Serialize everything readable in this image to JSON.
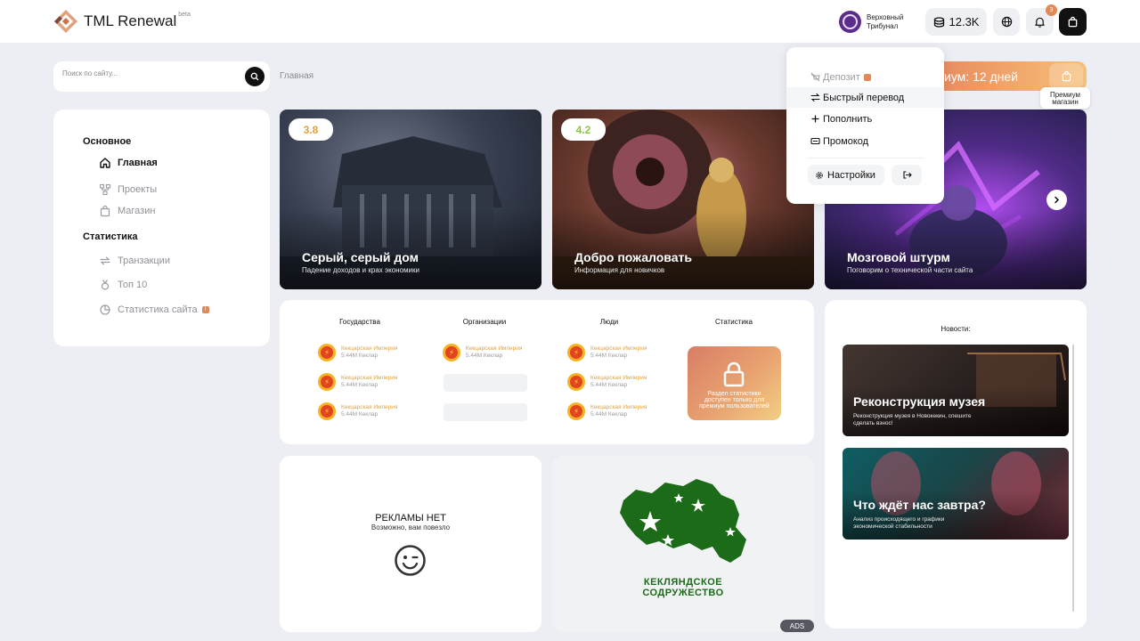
{
  "header": {
    "app_name": "TML Renewal",
    "beta_label": "beta",
    "user_name": "Верховный Трибунал",
    "balance": "12.3K",
    "notifications_count": "3"
  },
  "search": {
    "placeholder": "Поиск по сайту..."
  },
  "breadcrumb": "Главная",
  "premium": {
    "banner_text": "иум: 12 дней",
    "tooltip": "Премиум магазин"
  },
  "sidebar": {
    "sections": [
      {
        "title": "Основное",
        "items": [
          {
            "label": "Главная",
            "icon": "home-icon",
            "active": true
          },
          {
            "label": "Проекты",
            "icon": "projects-icon"
          },
          {
            "label": "Магазин",
            "icon": "shop-bag-icon"
          }
        ]
      },
      {
        "title": "Статистика",
        "items": [
          {
            "label": "Транзакции",
            "icon": "transactions-icon"
          },
          {
            "label": "Топ 10",
            "icon": "medal-icon"
          },
          {
            "label": "Статистика сайта",
            "icon": "pie-chart-icon",
            "badge": true
          }
        ]
      }
    ]
  },
  "hero_cards": [
    {
      "rating": "3.8",
      "rating_color": "#e0a33a",
      "title": "Серый, серый дом",
      "subtitle": "Падение доходов и крах экономики"
    },
    {
      "rating": "4.2",
      "rating_color": "#8cc63f",
      "title": "Добро пожаловать",
      "subtitle": "Информация для новичков"
    },
    {
      "title": "Мозговой штурм",
      "subtitle": "Поговорим о технической части сайта"
    }
  ],
  "dropdown": {
    "items": [
      {
        "label": "Депозит",
        "icon": "deposit-icon",
        "muted": true,
        "badge": true
      },
      {
        "label": "Быстрый перевод",
        "icon": "transfer-icon"
      },
      {
        "label": "Пополнить",
        "icon": "plus-icon"
      },
      {
        "label": "Промокод",
        "icon": "promo-ticket-icon"
      }
    ],
    "settings_label": "Настройки"
  },
  "stats": {
    "columns": [
      "Государства",
      "Организации",
      "Люди",
      "Статистика"
    ],
    "entry_name": "Кекцарская Империя",
    "entry_value": "5.44М Кеклар",
    "locked_text": "Раздел статистики доступен только для премиум пользователей"
  },
  "news": {
    "title": "Новости:",
    "items": [
      {
        "title": "Реконструкция музея",
        "subtitle": "Реконструкция музея в Новокекин, спешите сделать взнос!"
      },
      {
        "title": "Что ждёт нас завтра?",
        "subtitle": "Анализ происходящего и графики экономической стабильности"
      }
    ]
  },
  "ad": {
    "title": "РЕКЛАМЫ НЕТ",
    "subtitle": "Возможно, вам повезло",
    "badge": "ADS"
  },
  "nation": {
    "name_line1": "КЕКЛЯНДСКОЕ",
    "name_line2": "СОДРУЖЕСТВО",
    "color": "#1b6b18"
  },
  "colors": {
    "accent_orange": "#e08a5a",
    "background": "#eceef3"
  }
}
